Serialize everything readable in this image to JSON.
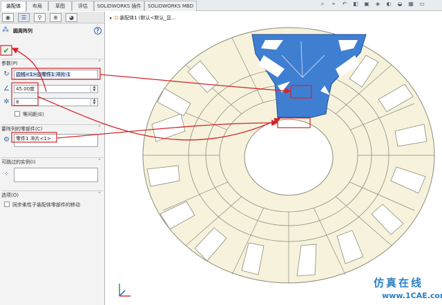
{
  "tabs": [
    "装配体",
    "布局",
    "草图",
    "评估",
    "SOLIDWORKS 插件",
    "SOLIDWORKS MBD"
  ],
  "toolbar_icons": [
    "feature-manager-icon",
    "property-manager-icon",
    "configuration-manager-icon",
    "dimxpert-icon",
    "display-manager-icon"
  ],
  "property_manager": {
    "title": "圆周阵列",
    "help": "?",
    "ok": "✔",
    "cancel": "✕",
    "parameters": {
      "header": "参数(P)",
      "axis_value": "边线<1>@零件1 冲片-1",
      "angle_value": "45.00度",
      "count_value": "8",
      "equal_spacing_label": "等间距(E)"
    },
    "parts_to_pattern": {
      "header": "要阵列的零部件(C)",
      "item": "零件1 冲片<1>"
    },
    "skip_instances": {
      "header": "可跳过的实例(I)"
    },
    "options": {
      "header": "选项(O)",
      "sync_label": "同步柔性子装配体零部件的移动"
    }
  },
  "graphics": {
    "tree_item": "装配体1 (默认<默认_显..."
  },
  "watermark": "1CAE.COM",
  "brand": {
    "name": "仿真在线",
    "url": "www.1CAE.com"
  },
  "colors": {
    "part_fill": "#f6f2dc",
    "part_edge": "#8c8a7a",
    "selected_part": "#3f7fd2",
    "callout": "#d3242a"
  }
}
